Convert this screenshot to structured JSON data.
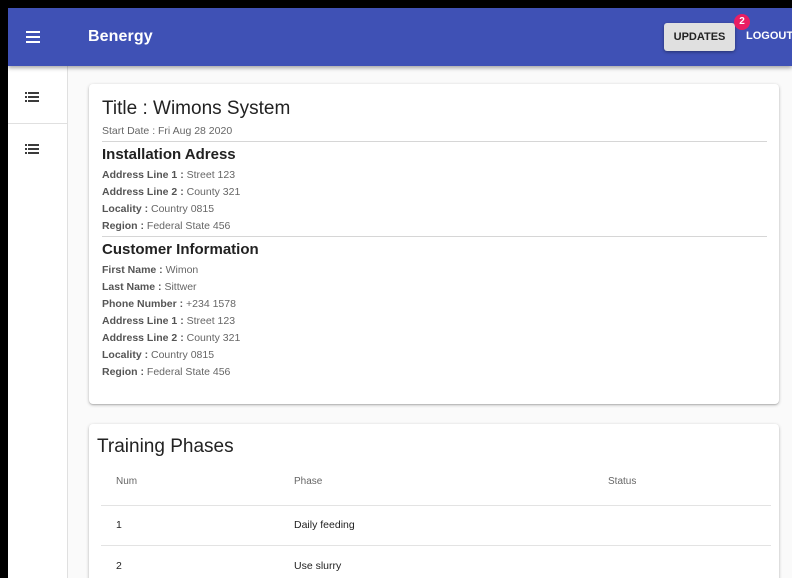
{
  "app": {
    "title": "Benergy",
    "updates_label": "UPDATES",
    "updates_badge": "2",
    "logout_label": "LOGOUT",
    "accent": "#3f51b5",
    "badge_color": "#e91e63"
  },
  "sidebar": {
    "items": [
      {
        "icon": "list-icon"
      },
      {
        "icon": "list-icon"
      }
    ]
  },
  "details": {
    "title": "Title : Wimons System",
    "start_date": "Start Date : Fri Aug 28 2020",
    "installation": {
      "heading": "Installation Adress",
      "fields": [
        {
          "label": "Address Line 1 :",
          "value": " Street 123"
        },
        {
          "label": "Address Line 2 :",
          "value": " County 321"
        },
        {
          "label": "Locality :",
          "value": " Country 0815"
        },
        {
          "label": "Region :",
          "value": " Federal State 456"
        }
      ]
    },
    "customer": {
      "heading": "Customer Information",
      "fields": [
        {
          "label": "First Name :",
          "value": " Wimon"
        },
        {
          "label": "Last Name :",
          "value": " Sittwer"
        },
        {
          "label": "Phone Number :",
          "value": " +234 1578"
        },
        {
          "label": "Address Line 1 :",
          "value": " Street 123"
        },
        {
          "label": "Address Line 2 :",
          "value": " County 321"
        },
        {
          "label": "Locality :",
          "value": " Country 0815"
        },
        {
          "label": "Region :",
          "value": " Federal State 456"
        }
      ]
    }
  },
  "training": {
    "title": "Training Phases",
    "columns": [
      "Num",
      "Phase",
      "Status"
    ],
    "rows": [
      {
        "num": "1",
        "phase": "Daily feeding",
        "status": ""
      },
      {
        "num": "2",
        "phase": "Use slurry",
        "status": ""
      }
    ]
  }
}
